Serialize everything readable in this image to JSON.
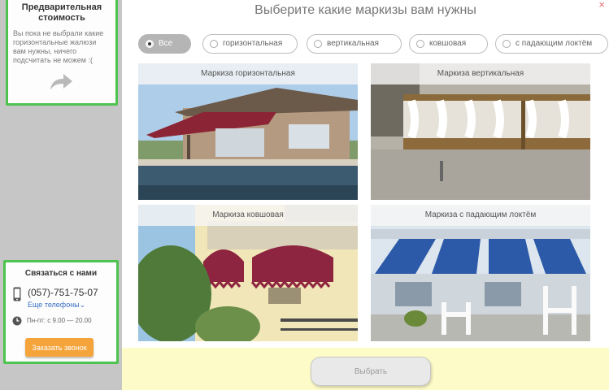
{
  "sidebar": {
    "price": {
      "title": "Предварительная стоимость",
      "note": "Вы пока не выбрали какие горизонтальные жалюзи вам нужны, ничего подсчитать не можем :("
    },
    "contact": {
      "title": "Связаться с нами",
      "phone": "(057)-751-75-07",
      "more_phones": "Еще телефоны",
      "hours": "Пн-пт: с 9.00 — 20.00",
      "callback_button": "Заказать звонок"
    }
  },
  "modal": {
    "title": "Выберите какие маркизы вам нужны",
    "close": "×",
    "filters": [
      {
        "label": "Все",
        "selected": true
      },
      {
        "label": "горизонтальная",
        "selected": false
      },
      {
        "label": "вертикальная",
        "selected": false
      },
      {
        "label": "ковшовая",
        "selected": false
      },
      {
        "label": "с падающим локтём",
        "selected": false
      }
    ],
    "cards": [
      {
        "label": "Маркиза горизонтальная"
      },
      {
        "label": "Маркиза вертикальная"
      },
      {
        "label": "Маркиза ковшовая"
      },
      {
        "label": "Маркиза с падающим локтём"
      }
    ],
    "select_button": "Выбрать"
  },
  "colors": {
    "accent_green": "#4ec34e",
    "callback_orange": "#f4a43a",
    "footer_yellow": "#fdfbc8"
  }
}
